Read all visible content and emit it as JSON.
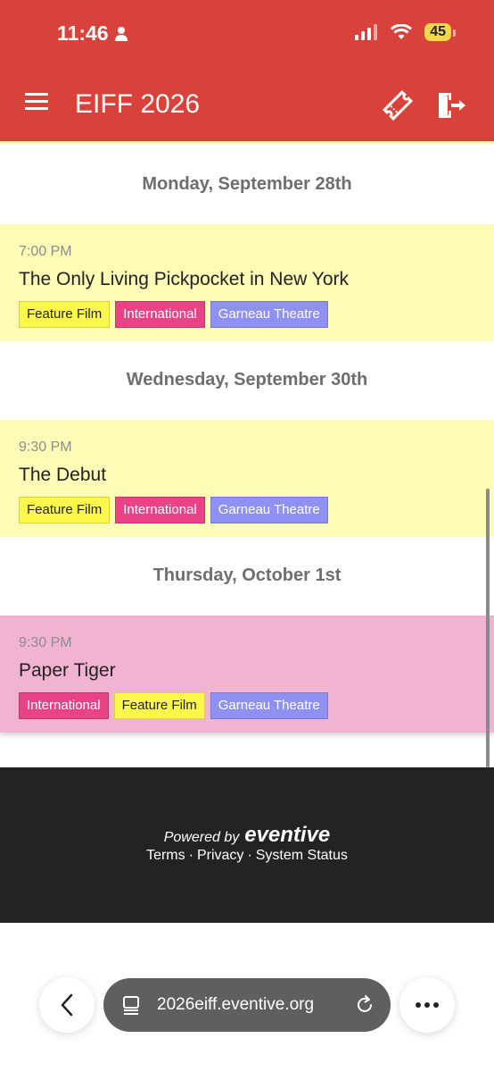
{
  "status_bar": {
    "time": "11:46",
    "battery": "45"
  },
  "app_bar": {
    "title": "EIFF 2026"
  },
  "days": [
    {
      "heading": "Monday, September 28th",
      "event": {
        "time": "7:00 PM",
        "title": "The Only Living Pickpocket in New York",
        "tags": [
          "Feature Film",
          "International",
          "Garneau Theatre"
        ]
      }
    },
    {
      "heading": "Wednesday, September 30th",
      "event": {
        "time": "9:30 PM",
        "title": "The Debut",
        "tags": [
          "Feature Film",
          "International",
          "Garneau Theatre"
        ]
      }
    },
    {
      "heading": "Thursday, October 1st",
      "event": {
        "time": "9:30 PM",
        "title": "Paper Tiger",
        "tags": [
          "International",
          "Feature Film",
          "Garneau Theatre"
        ]
      }
    }
  ],
  "footer": {
    "powered_by": "Powered by",
    "brand": "eventive",
    "links": {
      "terms": "Terms",
      "privacy": "Privacy",
      "status": "System Status"
    },
    "separator": "·"
  },
  "browser": {
    "url": "2026eiff.eventive.org"
  },
  "colors": {
    "app_bar": "#d9423a",
    "card_yellow": "#fdfbb6",
    "card_pink": "#f2b3d3",
    "tag_feature": "#fbf84b",
    "tag_international": "#e94287",
    "tag_theatre": "#8f91f2",
    "footer": "#232323"
  }
}
